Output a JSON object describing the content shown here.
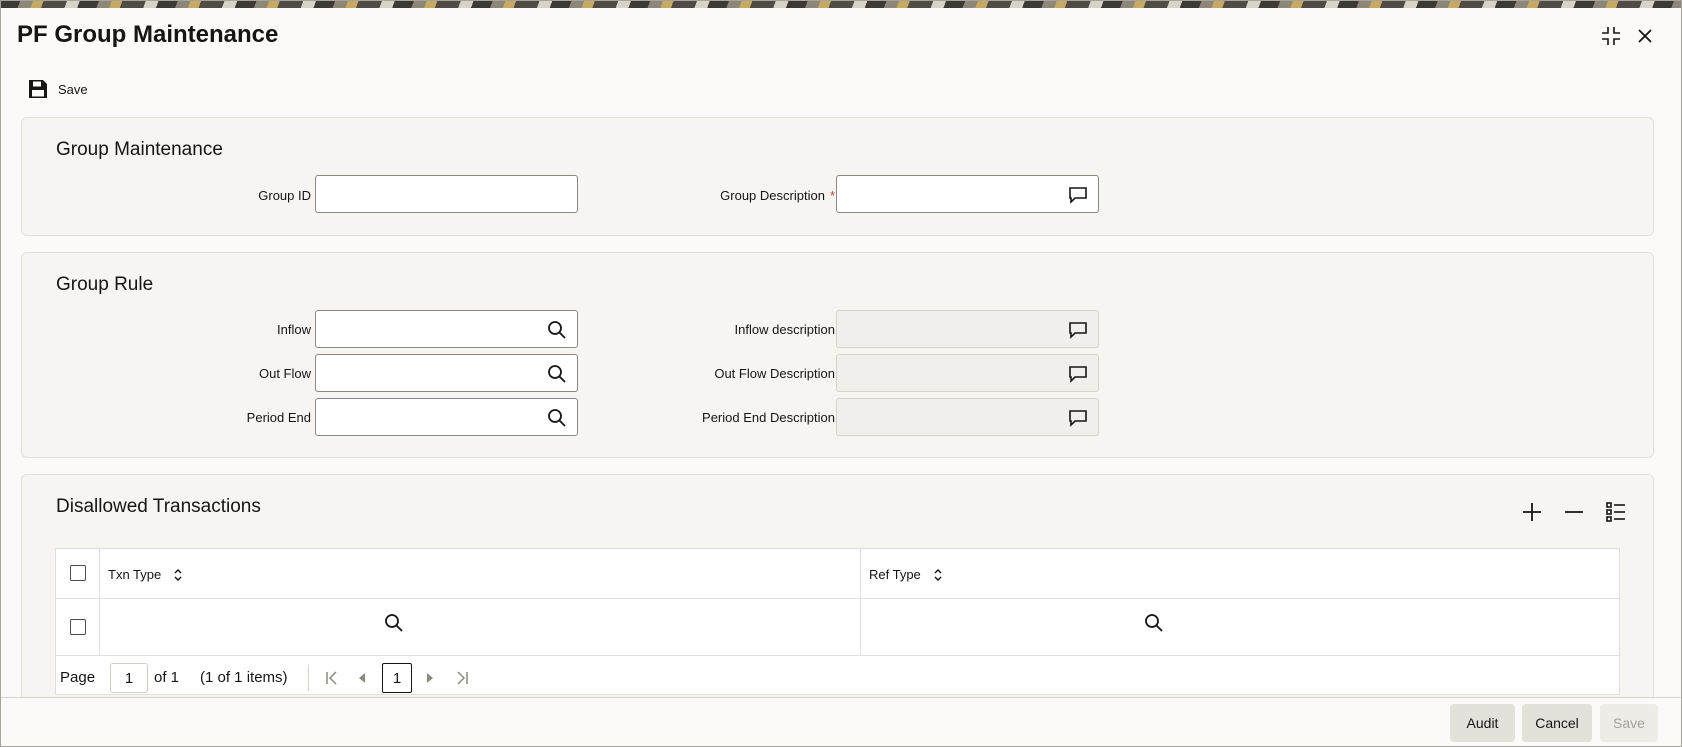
{
  "window": {
    "title": "PF Group Maintenance",
    "controls": [
      "restore-icon",
      "close-icon"
    ]
  },
  "toolbar": {
    "save_label": "Save",
    "save_icon": "floppy-disk-icon"
  },
  "group_maintenance": {
    "title": "Group Maintenance",
    "group_id": {
      "label": "Group ID",
      "value": ""
    },
    "group_description": {
      "label": "Group Description",
      "required_mark": "*",
      "value": ""
    }
  },
  "group_rule": {
    "title": "Group Rule",
    "inflow": {
      "label": "Inflow",
      "value": ""
    },
    "inflow_description": {
      "label": "Inflow description",
      "value": ""
    },
    "out_flow": {
      "label": "Out Flow",
      "value": ""
    },
    "out_flow_description": {
      "label": "Out Flow Description",
      "value": ""
    },
    "period_end": {
      "label": "Period End",
      "value": ""
    },
    "period_end_description": {
      "label": "Period End Description",
      "value": ""
    }
  },
  "disallowed": {
    "title": "Disallowed Transactions",
    "actions": [
      "add-row-icon",
      "remove-row-icon",
      "single-record-view-icon"
    ],
    "columns": [
      "Txn Type",
      "Ref Type"
    ],
    "rows": [
      {
        "txn_type": "",
        "ref_type": ""
      }
    ],
    "pager": {
      "page_label": "Page",
      "page_value": "1",
      "of_label": "of 1",
      "items_label": "(1 of 1 items)",
      "current_page": "1"
    }
  },
  "footer": {
    "audit": "Audit",
    "cancel": "Cancel",
    "save": "Save"
  },
  "colors": {
    "accent_required": "#c74634",
    "panel_bg": "#f6f5f2",
    "button_bg": "#e4e1db"
  }
}
